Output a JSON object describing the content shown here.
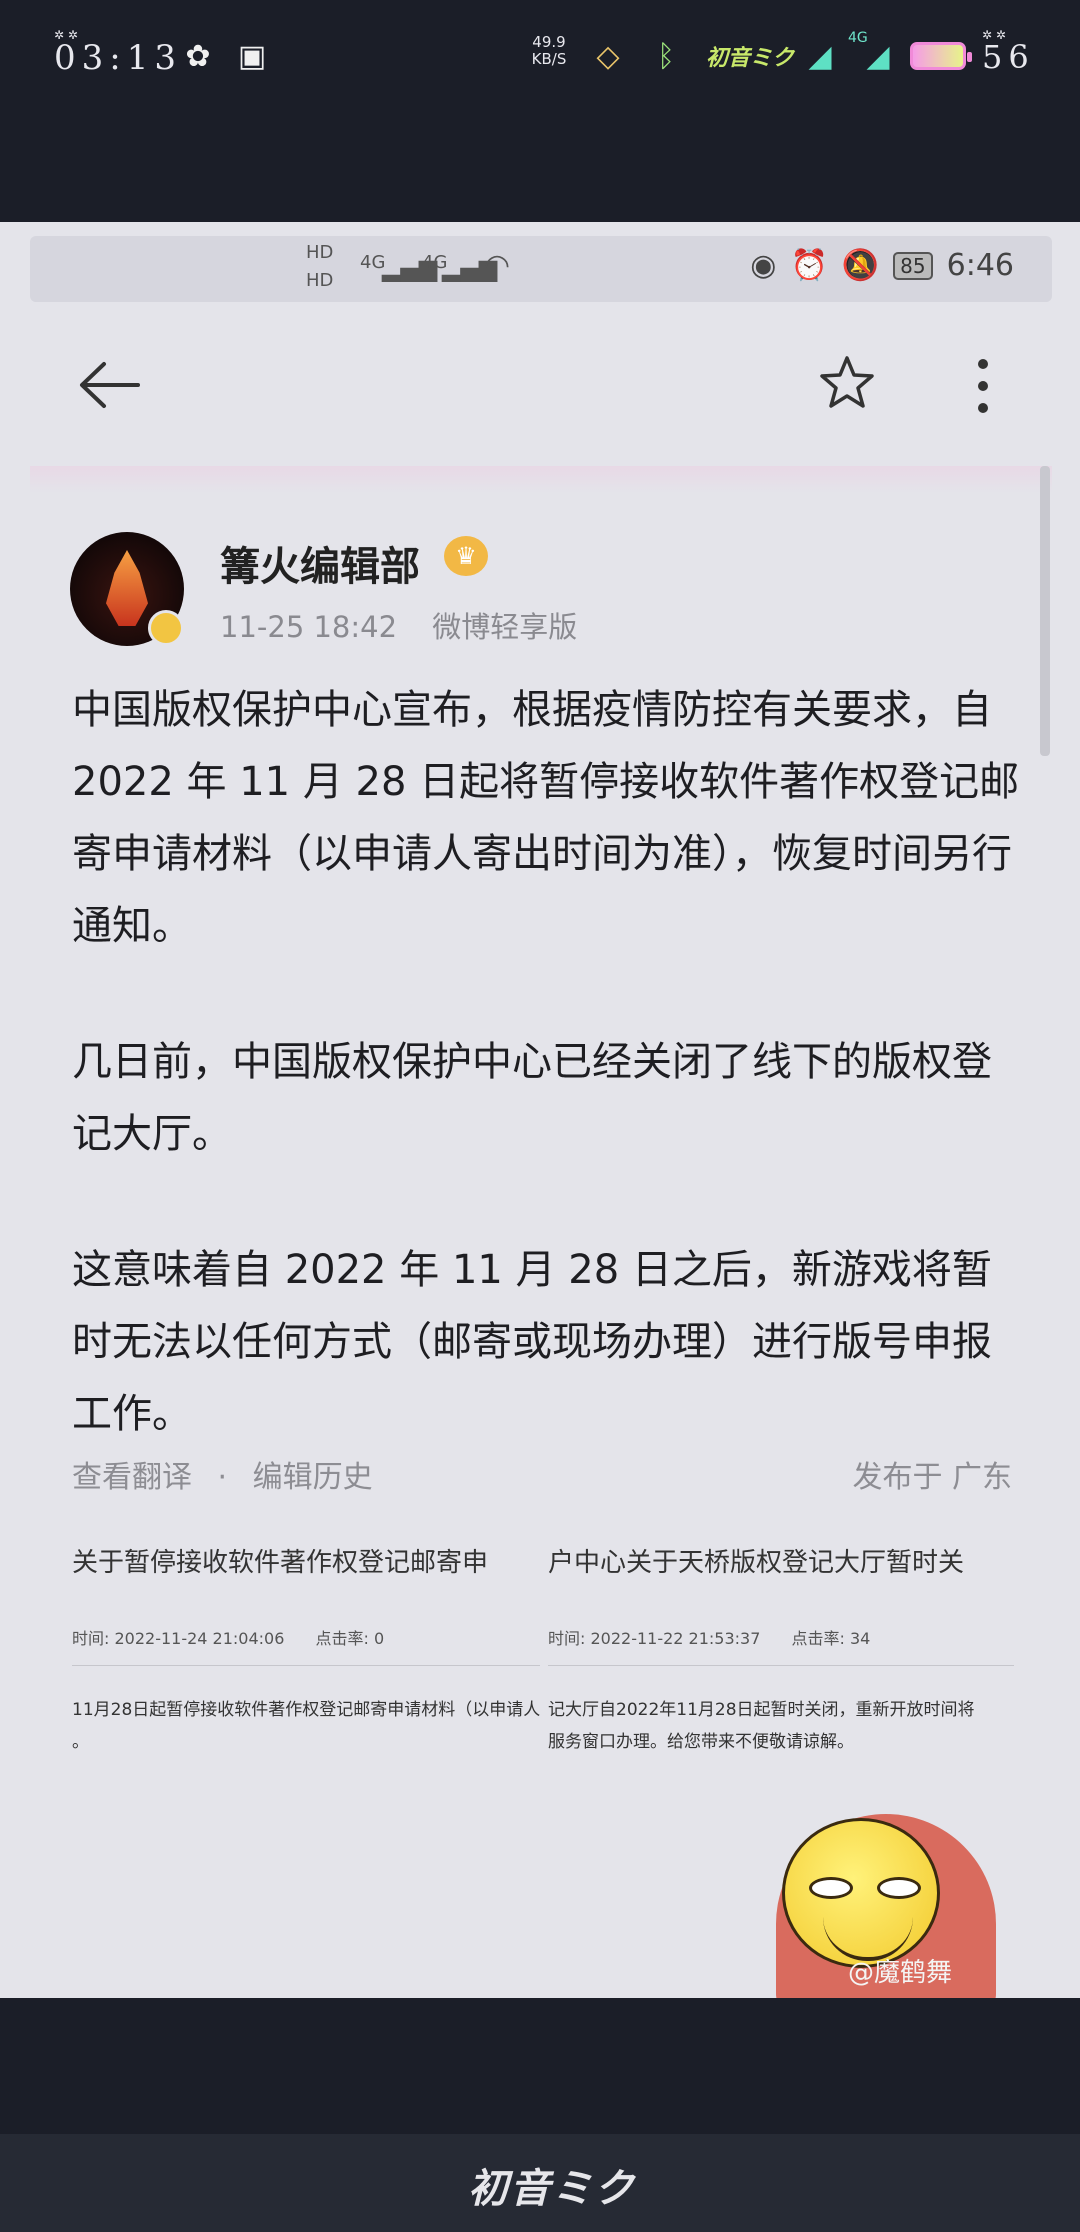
{
  "outer_status": {
    "time": "03:13",
    "net_speed_value": "49.9",
    "net_speed_unit": "KB/S",
    "network": "4G",
    "brand": "初音ミク",
    "battery": "56"
  },
  "inner_status": {
    "hd1": "HD",
    "hd2": "HD",
    "sig1": "4G",
    "sig2": "4G",
    "battery": "85",
    "time": "6:46"
  },
  "post": {
    "author": "篝火编辑部",
    "time": "11-25 18:42",
    "source": "微博轻享版",
    "paragraphs": [
      "中国版权保护中心宣布，根据疫情防控有关要求，自 2022 年 11 月 28 日起将暂停接收软件著作权登记邮寄申请材料（以申请人寄出时间为准），恢复时间另行通知。",
      "几日前，中国版权保护中心已经关闭了线下的版权登记大厅。",
      "这意味着自 2022 年 11 月 28 日之后，新游戏将暂时无法以任何方式（邮寄或现场办理）进行版号申报工作。"
    ],
    "action_translate": "查看翻译",
    "action_separator": "·",
    "action_history": "编辑历史",
    "location": "发布于 广东"
  },
  "embedded": [
    {
      "title": "关于暂停接收软件著作权登记邮寄申",
      "time": "时间: 2022-11-24 21:04:06",
      "clicks": "点击率: 0",
      "text": "11月28日起暂停接收软件著作权登记邮寄申请材料（以申请人",
      "text2": "。"
    },
    {
      "title": "户中心关于天桥版权登记大厅暂时关",
      "time": "时间: 2022-11-22 21:53:37",
      "clicks": "点击率: 34",
      "text": "记大厅自2022年11月28日起暂时关闭，重新开放时间将",
      "text2": "服务窗口办理。给您带来不便敬请谅解。"
    }
  ],
  "watermark": "@魔鹤舞",
  "nav_brand": "初音ミク"
}
